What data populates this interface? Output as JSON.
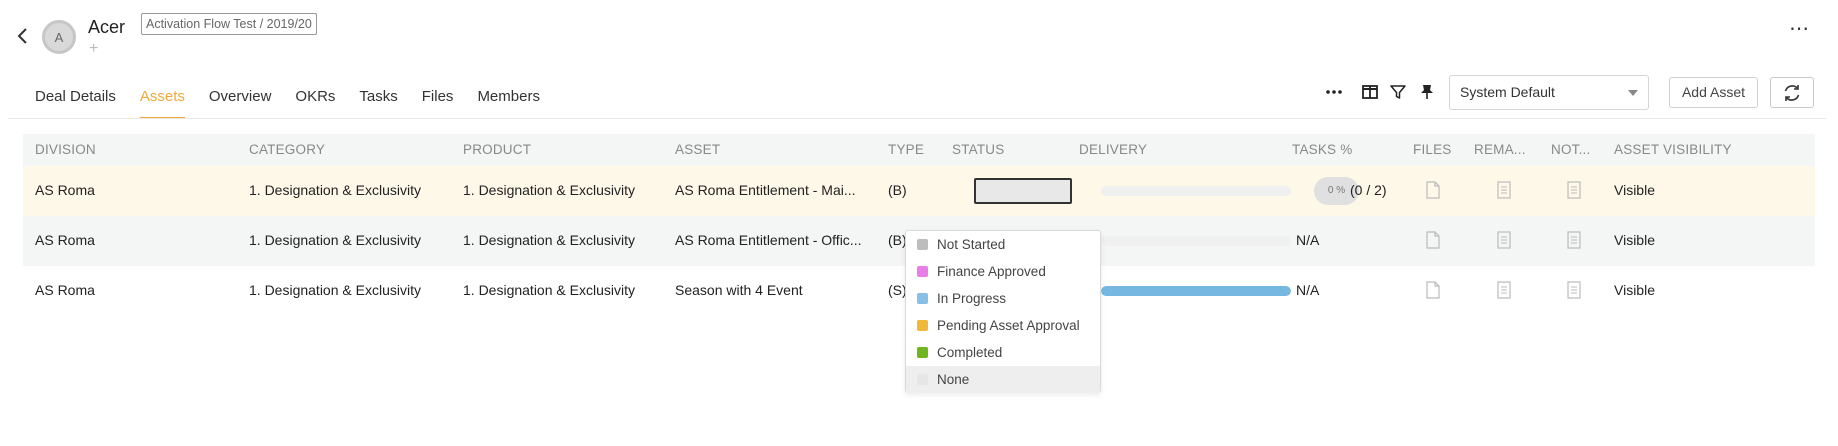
{
  "header": {
    "account_name": "Acer",
    "avatar_letter": "A",
    "tag": "Activation Flow Test / 2019/20",
    "plus": "+"
  },
  "tabs": [
    {
      "label": "Deal Details",
      "active": false
    },
    {
      "label": "Assets",
      "active": true
    },
    {
      "label": "Overview",
      "active": false
    },
    {
      "label": "OKRs",
      "active": false
    },
    {
      "label": "Tasks",
      "active": false
    },
    {
      "label": "Files",
      "active": false
    },
    {
      "label": "Members",
      "active": false
    }
  ],
  "toolbar": {
    "view_select": "System Default",
    "add_asset": "Add Asset"
  },
  "columns": [
    "DIVISION",
    "CATEGORY",
    "PRODUCT",
    "ASSET",
    "TYPE",
    "STATUS",
    "DELIVERY",
    "TASKS %",
    "FILES",
    "REMA...",
    "NOT...",
    "ASSET VISIBILITY"
  ],
  "rows": [
    {
      "division": "AS Roma",
      "category": "1. Designation & Exclusivity",
      "product": "1. Designation & Exclusivity",
      "asset": "AS Roma Entitlement - Mai...",
      "type": "(B)",
      "delivery_progress": 0,
      "tasks_pct": "0 %",
      "tasks_count": "(0 / 2)",
      "visibility": "Visible"
    },
    {
      "division": "AS Roma",
      "category": "1. Designation & Exclusivity",
      "product": "1. Designation & Exclusivity",
      "asset": "AS Roma Entitlement - Offic...",
      "type": "(B)",
      "delivery_progress": 0,
      "tasks_text": "N/A",
      "visibility": "Visible"
    },
    {
      "division": "AS Roma",
      "category": "1. Designation & Exclusivity",
      "product": "1. Designation & Exclusivity",
      "asset": "Season with 4 Event",
      "type": "(S)",
      "delivery_progress": 1,
      "tasks_text": "N/A",
      "visibility": "Visible"
    }
  ],
  "status_options": [
    {
      "label": "Not Started",
      "color": "#bdbdbd"
    },
    {
      "label": "Finance Approved",
      "color": "#e87ee6"
    },
    {
      "label": "In Progress",
      "color": "#87bfe6"
    },
    {
      "label": "Pending Asset Approval",
      "color": "#f0b93a"
    },
    {
      "label": "Completed",
      "color": "#6fb51f"
    },
    {
      "label": "None",
      "color": "#e6e6e6"
    }
  ],
  "colors": {
    "accent": "#f0a93a",
    "highlight_row": "#fef8e9",
    "progress": "#76b7e1"
  }
}
